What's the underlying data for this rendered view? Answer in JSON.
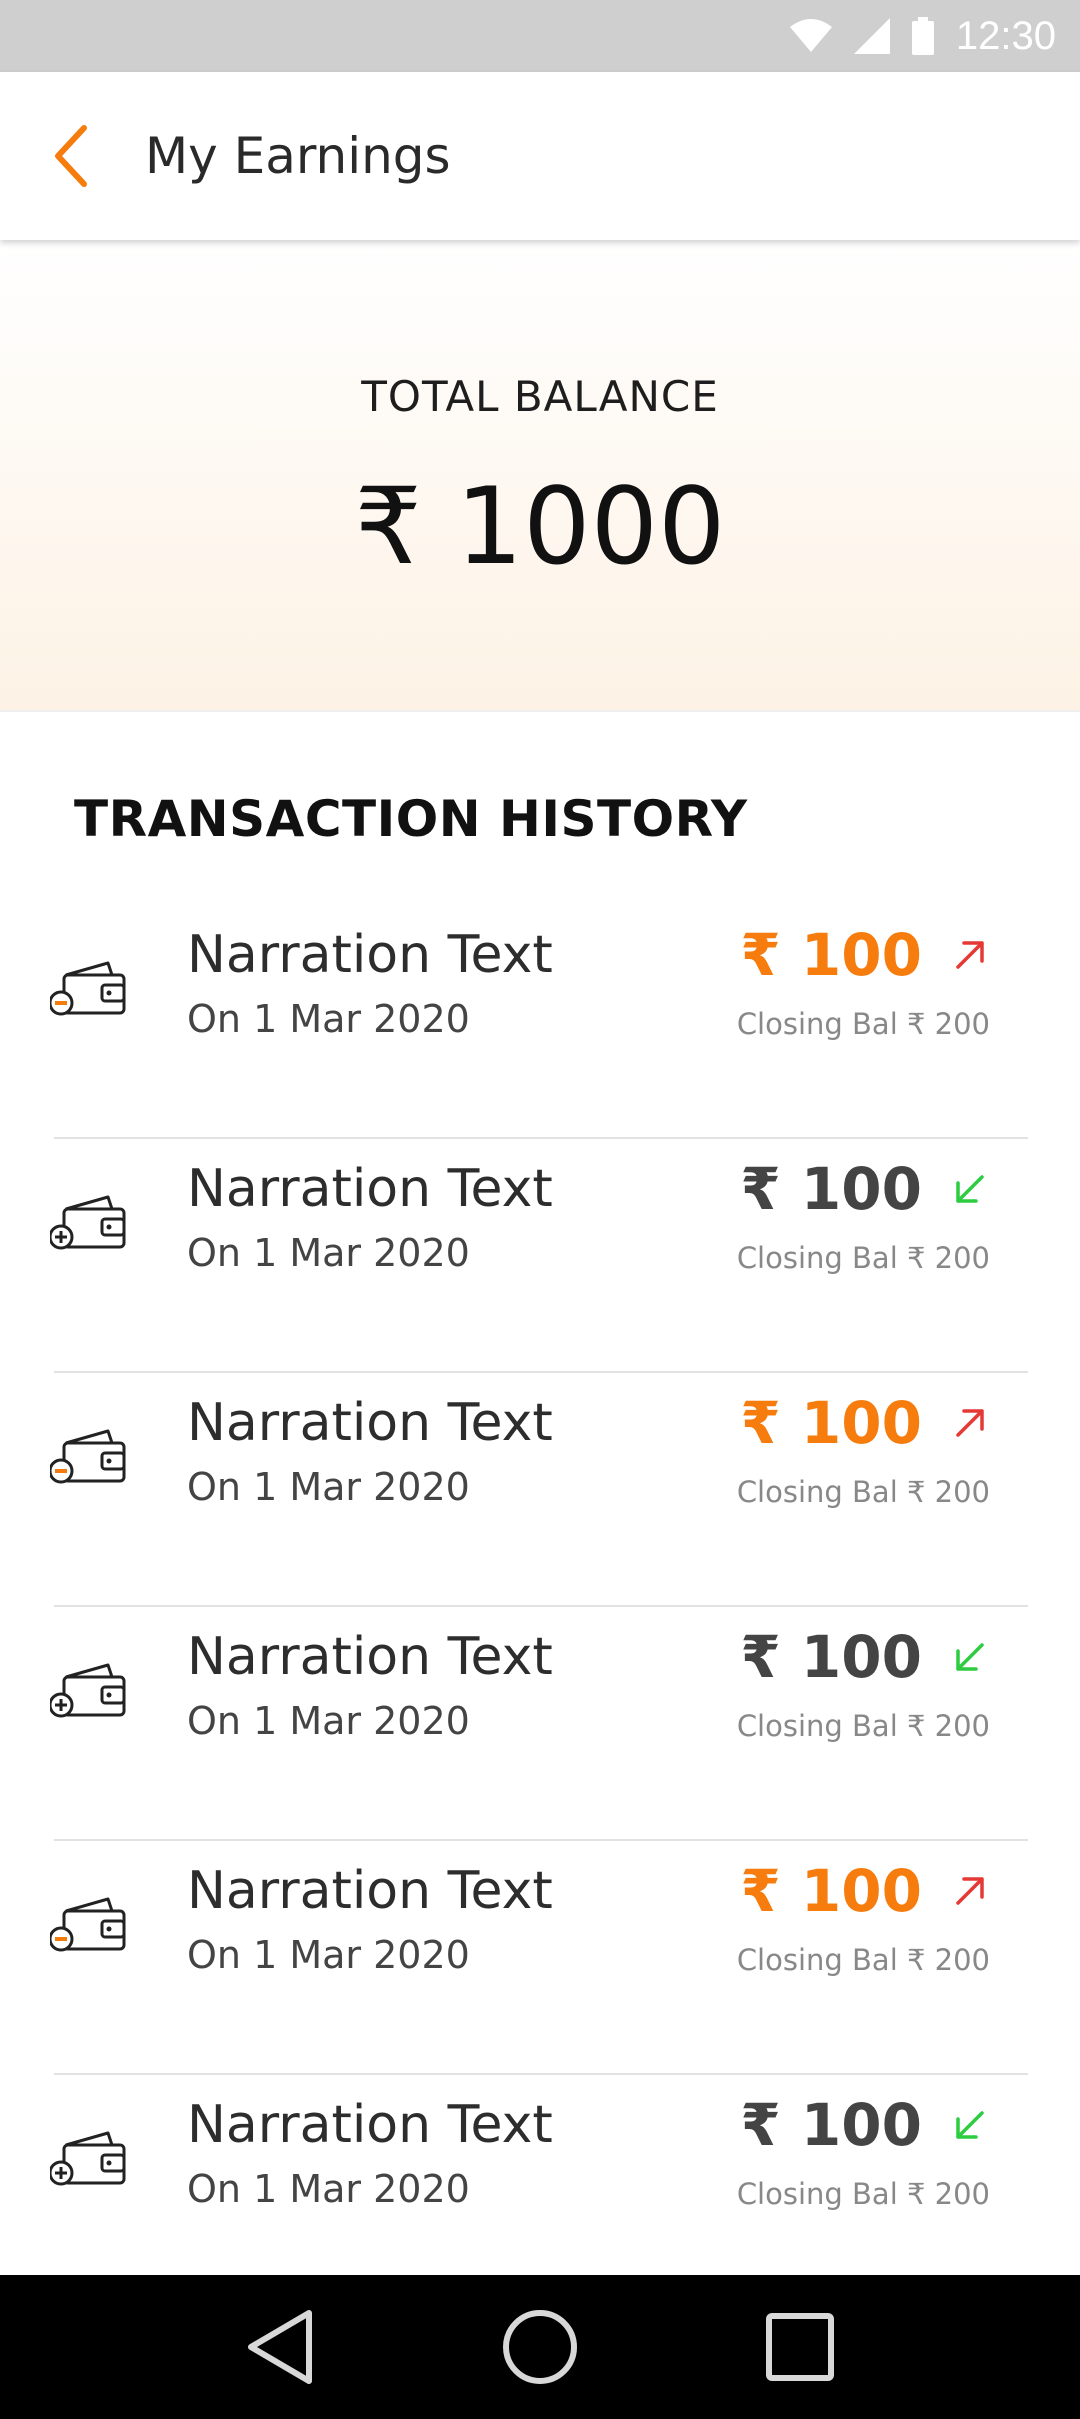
{
  "status_bar": {
    "time": "12:30",
    "icons": [
      "wifi-icon",
      "signal-icon",
      "battery-icon"
    ]
  },
  "app_bar": {
    "title": "My Earnings",
    "back_icon": "chevron-left-icon"
  },
  "balance": {
    "label": "TOTAL BALANCE",
    "amount": "₹ 1000"
  },
  "history": {
    "title": "TRANSACTION HISTORY",
    "items": [
      {
        "narration": "Narration Text",
        "date": "On 1 Mar 2020",
        "amount": "₹ 100",
        "closing": "Closing Bal ₹ 200",
        "type": "debit",
        "icon": "wallet-minus-icon",
        "arrow": "arrow-up-right-icon"
      },
      {
        "narration": "Narration Text",
        "date": "On 1 Mar 2020",
        "amount": "₹ 100",
        "closing": "Closing Bal ₹ 200",
        "type": "credit",
        "icon": "wallet-plus-icon",
        "arrow": "arrow-down-left-icon"
      },
      {
        "narration": "Narration Text",
        "date": "On 1 Mar 2020",
        "amount": "₹ 100",
        "closing": "Closing Bal ₹ 200",
        "type": "debit",
        "icon": "wallet-minus-icon",
        "arrow": "arrow-up-right-icon"
      },
      {
        "narration": "Narration Text",
        "date": "On 1 Mar 2020",
        "amount": "₹ 100",
        "closing": "Closing Bal ₹ 200",
        "type": "credit",
        "icon": "wallet-plus-icon",
        "arrow": "arrow-down-left-icon"
      },
      {
        "narration": "Narration Text",
        "date": "On 1 Mar 2020",
        "amount": "₹ 100",
        "closing": "Closing Bal ₹ 200",
        "type": "debit",
        "icon": "wallet-minus-icon",
        "arrow": "arrow-up-right-icon"
      },
      {
        "narration": "Narration Text",
        "date": "On 1 Mar 2020",
        "amount": "₹ 100",
        "closing": "Closing Bal ₹ 200",
        "type": "credit",
        "icon": "wallet-plus-icon",
        "arrow": "arrow-down-left-icon"
      }
    ]
  },
  "nav_bar": {
    "icons": [
      "back-triangle-icon",
      "home-circle-icon",
      "recents-square-icon"
    ]
  },
  "colors": {
    "accent": "#f57c0d",
    "debit_arrow": "#e53935",
    "credit_arrow": "#2ecc40",
    "banner_end": "#fdf2e5"
  }
}
